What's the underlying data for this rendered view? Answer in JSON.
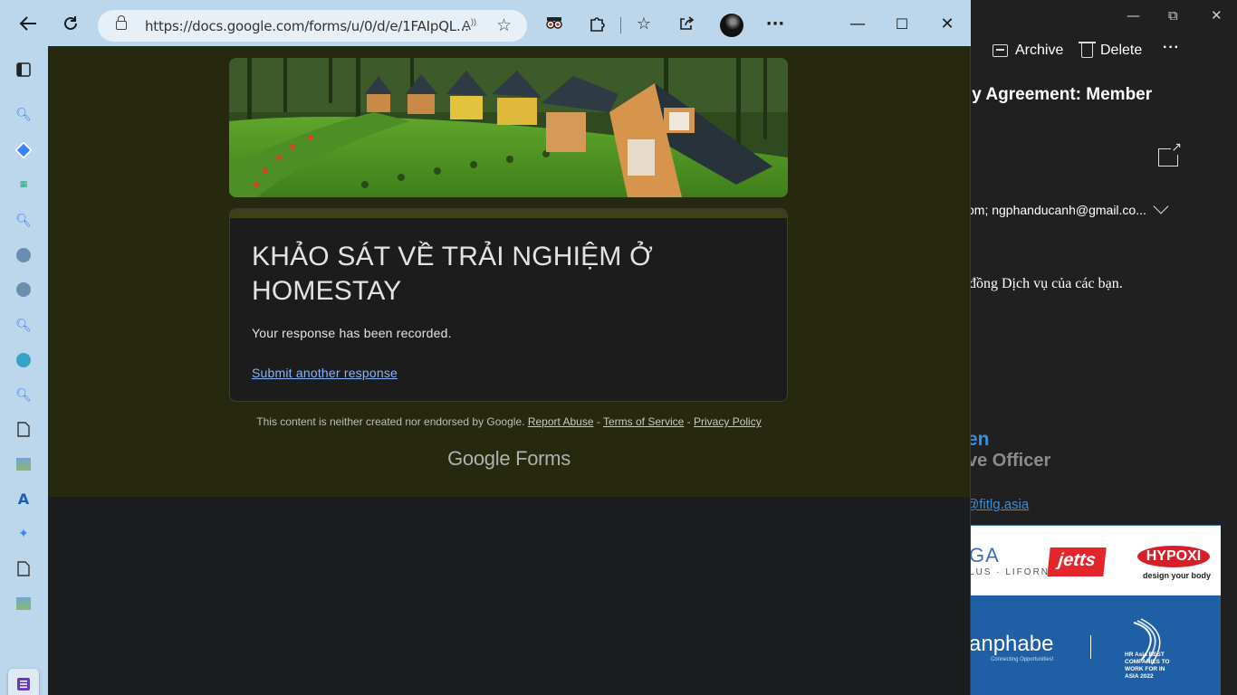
{
  "browser": {
    "url": "https://docs.google.com/forms/u/0/d/e/1FAIpQL...",
    "icons": {
      "back": "back-arrow-icon",
      "refresh": "refresh-icon",
      "read_aloud": "read-aloud-icon",
      "add_favorite": "add-favorite-icon",
      "extension": "extension-icon",
      "puzzle": "puzzle-icon",
      "favorites": "favorites-icon",
      "share": "share-icon",
      "more": "more-icon"
    },
    "window_controls": {
      "minimize": "—",
      "maximize": "☐",
      "close": "✕"
    }
  },
  "mail": {
    "window_controls": {
      "minimize": "—",
      "restore": "⧉",
      "close": "✕"
    },
    "toolbar": {
      "archive": "Archive",
      "delete": "Delete",
      "more": "···"
    },
    "subject": "ly Agreement: Member",
    "recipients": "om; ngphanducanh@gmail.co...",
    "body_text": "đồng Dịch vụ của các bạn.",
    "sig_name": "en",
    "sig_title": "ve Officer",
    "sig_email": "@fitlg.asia",
    "logos": {
      "yoga": "GA",
      "yoga_sub": "LUS · LIFORNIA",
      "jetts": "jetts",
      "hypoxi": "HYPOXI",
      "hypoxi_sub": "design your body",
      "anphabe": "anphabe",
      "anphabe_sub": "Connecting Opportunities!",
      "hr_asia": "HR Asia BEST COMPANIES TO WORK FOR IN ASIA 2022"
    }
  },
  "form": {
    "title": "KHẢO SÁT VỀ TRẢI NGHIỆM Ở HOMESTAY",
    "confirmation": "Your response has been recorded.",
    "another_link": "Submit another response",
    "footer_text": "This content is neither created nor endorsed by Google.",
    "footer_links": [
      "Report Abuse",
      "Terms of Service",
      "Privacy Policy"
    ],
    "brand": "Google Forms"
  },
  "colors": {
    "titlebar": "#bcd6ec",
    "form_bg": "#27290f",
    "card_accent": "#3d4018",
    "link": "#8ab4f8"
  }
}
